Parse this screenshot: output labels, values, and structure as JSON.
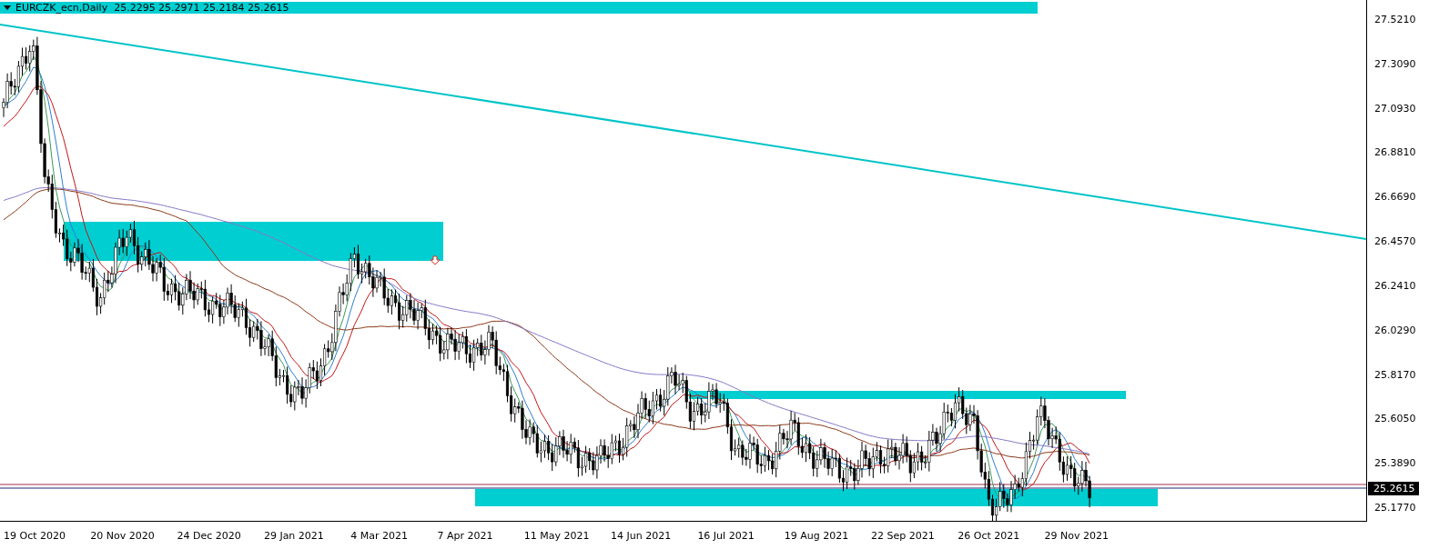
{
  "chart_header": {
    "title": "EURCZK_ecn,Daily  25.2295 25.2971 25.2184 25.2615"
  },
  "price_axis": {
    "labels": [
      "27.5210",
      "27.3090",
      "27.0930",
      "26.8810",
      "26.6690",
      "26.4570",
      "26.2410",
      "26.0290",
      "25.8170",
      "25.6050",
      "25.3890",
      "25.1770"
    ],
    "current_price": "25.2615"
  },
  "time_axis": {
    "labels": [
      "19 Oct 2020",
      "20 Nov 2020",
      "24 Dec 2020",
      "29 Jan 2021",
      "4 Mar 2021",
      "7 Apr 2021",
      "11 May 2021",
      "14 Jun 2021",
      "16 Jul 2021",
      "19 Aug 2021",
      "22 Sep 2021",
      "26 Oct 2021",
      "29 Nov 2021"
    ]
  }
}
